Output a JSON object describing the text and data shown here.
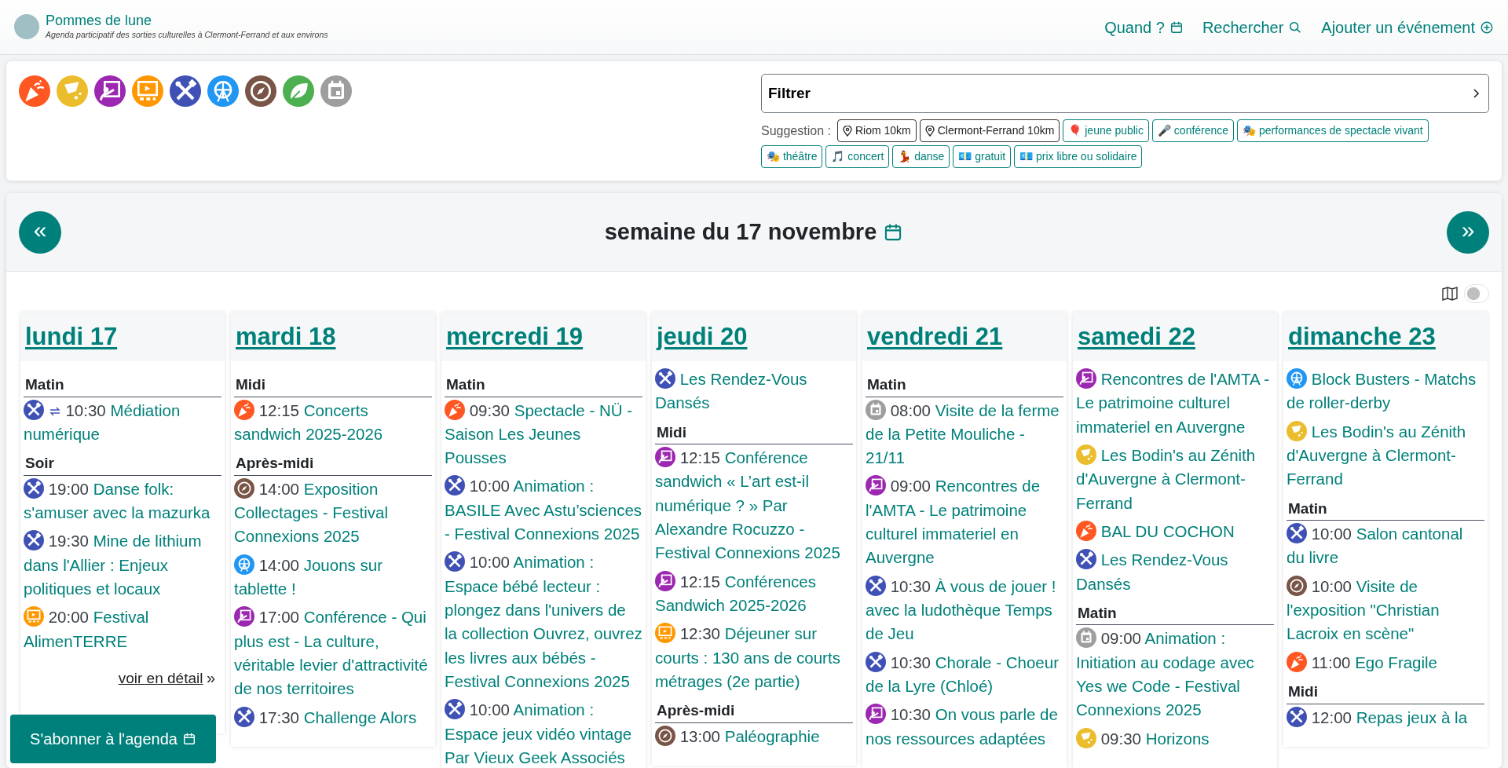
{
  "site": {
    "title": "Pommes de lune",
    "tagline": "Agenda participatif des sorties culturelles à Clermont-Ferrand et aux environs"
  },
  "nav": [
    {
      "label": "Quand ?"
    },
    {
      "label": "Rechercher"
    },
    {
      "label": "Ajouter un événement"
    }
  ],
  "categories": [
    {
      "kind": "party",
      "color": "#ff5722"
    },
    {
      "kind": "comedy",
      "color": "#ebbd2d"
    },
    {
      "kind": "conference",
      "color": "#9c27b0"
    },
    {
      "kind": "cinema",
      "color": "#ff9800"
    },
    {
      "kind": "workshop",
      "color": "#3f51b5"
    },
    {
      "kind": "fair",
      "color": "#2196f3"
    },
    {
      "kind": "visit",
      "color": "#795548"
    },
    {
      "kind": "nature",
      "color": "#4caf50"
    },
    {
      "kind": "other",
      "color": "#9e9e9e"
    }
  ],
  "filter": {
    "label": "Filtrer",
    "suggestion_label": "Suggestion :",
    "suggestions": [
      {
        "kind": "place",
        "label": "Riom 10km"
      },
      {
        "kind": "place",
        "label": "Clermont-Ferrand 10km"
      },
      {
        "kind": "tag",
        "emoji": "🎈",
        "label": "jeune public"
      },
      {
        "kind": "tag",
        "emoji": "🎤",
        "label": "conférence"
      },
      {
        "kind": "tag",
        "emoji": "🎭",
        "label": "performances de spectacle vivant"
      },
      {
        "kind": "tag",
        "emoji": "🎭",
        "label": "théâtre"
      },
      {
        "kind": "tag",
        "emoji": "🎵",
        "label": "concert"
      },
      {
        "kind": "tag",
        "emoji": "💃",
        "label": "danse"
      },
      {
        "kind": "tag",
        "emoji": "💶",
        "label": "gratuit"
      },
      {
        "kind": "tag",
        "emoji": "💶",
        "label": "prix libre ou solidaire"
      }
    ]
  },
  "week": {
    "prev": "«",
    "next": "»",
    "title": "semaine du 17 novembre",
    "map_view": {
      "on": false
    }
  },
  "days": [
    {
      "title": "lundi 17",
      "groups": [
        {
          "label": "Matin",
          "events": [
            {
              "time": "10:30",
              "title": "Médiation numérique",
              "kind": "workshop",
              "recurring": true
            }
          ]
        },
        {
          "label": "Soir",
          "events": [
            {
              "time": "19:00",
              "title": "Danse folk: s'amuser avec la mazurka",
              "kind": "workshop",
              "recurring": false
            },
            {
              "time": "19:30",
              "title": "Mine de lithium dans l'Allier : Enjeux politiques et locaux",
              "kind": "workshop",
              "recurring": false
            },
            {
              "time": "20:00",
              "title": "Festival AlimenTERRE",
              "kind": "cinema",
              "recurring": false
            }
          ]
        }
      ],
      "more": {
        "label": "voir en détail",
        "arrow": "»"
      }
    },
    {
      "title": "mardi 18",
      "groups": [
        {
          "label": "Midi",
          "events": [
            {
              "time": "12:15",
              "title": "Concerts sandwich 2025-2026",
              "kind": "party",
              "recurring": false
            }
          ]
        },
        {
          "label": "Après-midi",
          "events": [
            {
              "time": "14:00",
              "title": "Exposition Collectages - Festival Connexions 2025",
              "kind": "visit",
              "recurring": false
            },
            {
              "time": "14:00",
              "title": "Jouons sur tablette !",
              "kind": "fair",
              "recurring": false
            },
            {
              "time": "17:00",
              "title": "Conférence - Qui plus est - La culture, véritable levier d'attractivité de nos territoires",
              "kind": "conference",
              "recurring": false
            },
            {
              "time": "17:30",
              "title": "Challenge Alors",
              "kind": "workshop",
              "recurring": false
            }
          ]
        }
      ]
    },
    {
      "title": "mercredi 19",
      "groups": [
        {
          "label": "Matin",
          "events": [
            {
              "time": "09:30",
              "title": "Spectacle - NÜ - Saison Les Jeunes Pousses",
              "kind": "party",
              "recurring": false
            },
            {
              "time": "10:00",
              "title": "Animation : BASILE Avec Astu’sciences - Festival Connexions 2025",
              "kind": "workshop",
              "recurring": false
            },
            {
              "time": "10:00",
              "title": "Animation : Espace bébé lecteur : plongez dans l'univers de la collection Ouvrez, ouvrez les livres aux bébés - Festival Connexions 2025",
              "kind": "workshop",
              "recurring": false
            },
            {
              "time": "10:00",
              "title": "Animation : Espace jeux vidéo vintage Par Vieux Geek Associés",
              "kind": "workshop",
              "recurring": false
            }
          ]
        }
      ]
    },
    {
      "title": "jeudi 20",
      "groups": [
        {
          "events": [
            {
              "title": "Les Rendez-Vous Dansés",
              "kind": "workshop",
              "recurring": false
            }
          ]
        },
        {
          "label": "Midi",
          "events": [
            {
              "time": "12:15",
              "title": "Conférence sandwich « L’art est-il numérique ? » Par Alexandre Rocuzzo - Festival Connexions 2025",
              "kind": "conference",
              "recurring": false
            },
            {
              "time": "12:15",
              "title": "Conférences Sandwich 2025-2026",
              "kind": "conference",
              "recurring": false
            },
            {
              "time": "12:30",
              "title": "Déjeuner sur courts : 130 ans de courts métrages (2e partie)",
              "kind": "cinema",
              "recurring": false
            }
          ]
        },
        {
          "label": "Après-midi",
          "events": [
            {
              "time": "13:00",
              "title": "Paléographie",
              "kind": "visit",
              "recurring": false
            }
          ]
        }
      ]
    },
    {
      "title": "vendredi 21",
      "groups": [
        {
          "label": "Matin",
          "events": [
            {
              "time": "08:00",
              "title": "Visite de la ferme de la Petite Mouliche - 21/11",
              "kind": "other",
              "recurring": false
            },
            {
              "time": "09:00",
              "title": "Rencontres de l'AMTA - Le patrimoine culturel immateriel en Auvergne",
              "kind": "conference",
              "recurring": false
            },
            {
              "time": "10:30",
              "title": "À vous de jouer ! avec la ludothèque Temps de Jeu",
              "kind": "workshop",
              "recurring": false
            },
            {
              "time": "10:30",
              "title": "Chorale - Choeur de la Lyre (Chloé)",
              "kind": "workshop",
              "recurring": false
            },
            {
              "time": "10:30",
              "title": "On vous parle de nos ressources adaptées",
              "kind": "conference",
              "recurring": false
            }
          ]
        }
      ]
    },
    {
      "title": "samedi 22",
      "groups": [
        {
          "events": [
            {
              "title": "Rencontres de l'AMTA - Le patrimoine culturel immateriel en Auvergne",
              "kind": "conference",
              "recurring": false
            },
            {
              "title": "Les Bodin's au Zénith d'Auvergne à Clermont-Ferrand",
              "kind": "comedy",
              "recurring": false
            },
            {
              "title": "BAL DU COCHON",
              "kind": "party",
              "recurring": false
            },
            {
              "title": "Les Rendez-Vous Dansés",
              "kind": "workshop",
              "recurring": false
            }
          ]
        },
        {
          "label": "Matin",
          "events": [
            {
              "time": "09:00",
              "title": "Animation : Initiation au codage avec Yes we Code - Festival Connexions 2025",
              "kind": "other",
              "recurring": false
            },
            {
              "time": "09:30",
              "title": "Horizons",
              "kind": "comedy",
              "recurring": false
            }
          ]
        }
      ]
    },
    {
      "title": "dimanche 23",
      "groups": [
        {
          "events": [
            {
              "title": "Block Busters - Matchs de roller-derby",
              "kind": "fair",
              "recurring": false
            },
            {
              "title": "Les Bodin's au Zénith d'Auvergne à Clermont-Ferrand",
              "kind": "comedy",
              "recurring": false
            }
          ]
        },
        {
          "label": "Matin",
          "events": [
            {
              "time": "10:00",
              "title": "Salon cantonal du livre",
              "kind": "workshop",
              "recurring": false
            },
            {
              "time": "10:00",
              "title": "Visite de l'exposition \"Christian Lacroix en scène\"",
              "kind": "visit",
              "recurring": false
            },
            {
              "time": "11:00",
              "title": "Ego Fragile",
              "kind": "party",
              "recurring": false
            }
          ]
        },
        {
          "label": "Midi",
          "events": [
            {
              "time": "12:00",
              "title": "Repas jeux à la",
              "kind": "workshop",
              "recurring": false
            }
          ]
        }
      ]
    }
  ],
  "subscribe": {
    "label": "S'abonner à l'agenda"
  }
}
